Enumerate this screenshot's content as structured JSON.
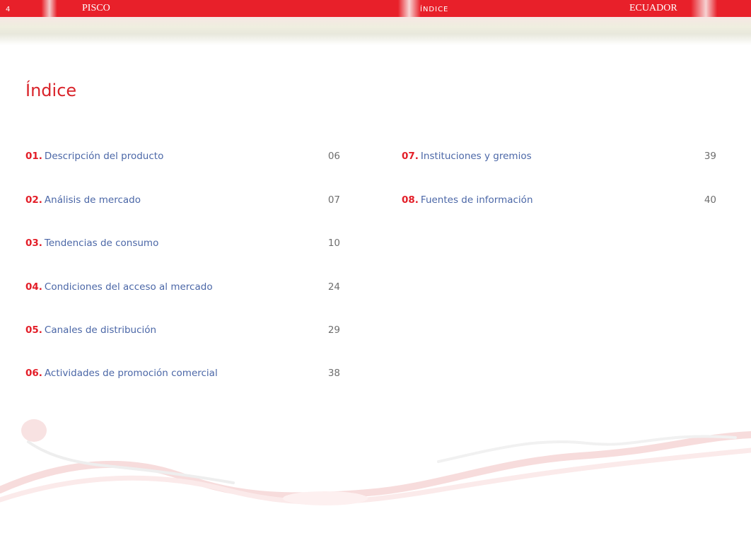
{
  "header": {
    "page_number": "4",
    "left_title": "PISCO",
    "center_title": "Índice",
    "right_title": "ECUADOR"
  },
  "main": {
    "title": "Índice"
  },
  "toc": {
    "left": [
      {
        "num": "01.",
        "label": "Descripción del producto",
        "page": "06"
      },
      {
        "num": "02.",
        "label": "Análisis de mercado",
        "page": "07"
      },
      {
        "num": "03.",
        "label": "Tendencias de consumo",
        "page": "10"
      },
      {
        "num": "04.",
        "label": "Condiciones del acceso al mercado",
        "page": "24"
      },
      {
        "num": "05.",
        "label": "Canales de distribución",
        "page": "29"
      },
      {
        "num": "06.",
        "label": "Actividades de promoción comercial",
        "page": "38"
      }
    ],
    "right": [
      {
        "num": "07.",
        "label": "Instituciones y gremios",
        "page": "39"
      },
      {
        "num": "08.",
        "label": "Fuentes de información",
        "page": "40"
      }
    ]
  },
  "colors": {
    "accent_red": "#e31e28",
    "link_blue": "#4b67a7",
    "page_number_gray": "#6e6e6e"
  }
}
